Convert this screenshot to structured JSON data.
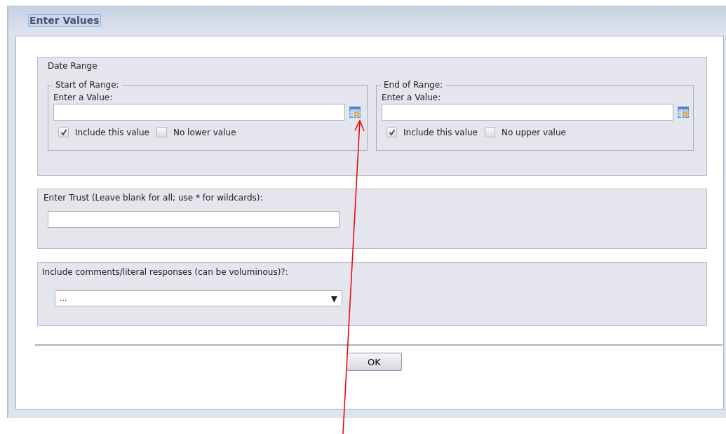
{
  "window": {
    "title": "Enter Values"
  },
  "date_range": {
    "title": "Date Range",
    "ends": [
      {
        "legend": "Start of Range:",
        "label": "Enter a Value:",
        "options": [
          {
            "label": "Include this value",
            "checked": true
          },
          {
            "label": "No lower value",
            "checked": false
          }
        ]
      },
      {
        "legend": "End of Range:",
        "label": "Enter a Value:",
        "options": [
          {
            "label": "Include this value",
            "checked": true
          },
          {
            "label": "No upper value",
            "checked": false
          }
        ]
      }
    ]
  },
  "trust": {
    "label": "Enter Trust (Leave blank for all; use * for wildcards):"
  },
  "comments": {
    "label": "Include comments/literal responses (can be voluminous)?:",
    "value": "...",
    "arrow": "▼"
  },
  "buttons": [
    "OK"
  ]
}
